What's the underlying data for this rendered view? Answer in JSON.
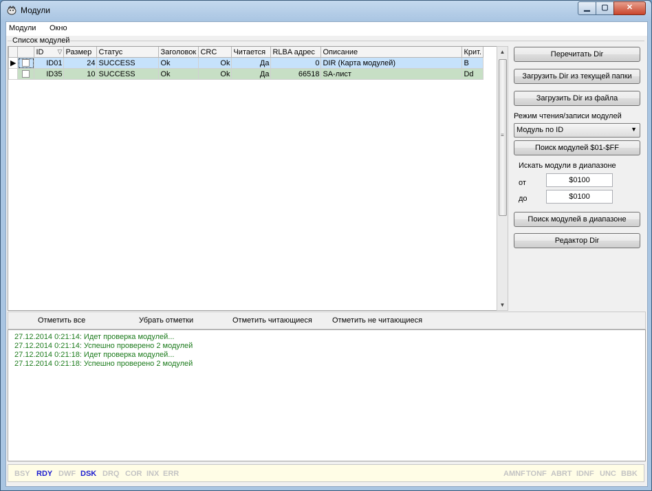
{
  "window": {
    "title": "Модули",
    "minimize": "▁",
    "maximize": "▢",
    "close": "✕"
  },
  "menu": {
    "items": [
      "Модули",
      "Окно"
    ]
  },
  "group": {
    "label": "Список модулей"
  },
  "table": {
    "headers": [
      "ID",
      "Размер",
      "Статус",
      "Заголовок",
      "CRC",
      "Читается",
      "RLBA адрес",
      "Описание",
      "Крит."
    ],
    "sort_indicator": "▽",
    "rows": [
      {
        "id": "ID01",
        "size": "24",
        "status": "SUCCESS",
        "header": "Ok",
        "crc": "Ok",
        "readable": "Да",
        "rlba": "0",
        "description": "DIR (Карта модулей)",
        "crit": "B"
      },
      {
        "id": "ID35",
        "size": "10",
        "status": "SUCCESS",
        "header": "Ok",
        "crc": "Ok",
        "readable": "Да",
        "rlba": "66518",
        "description": "SA-лист",
        "crit": "Dd"
      }
    ],
    "selected_row_color": "#c6e2fb",
    "second_row_color": "#c7dfc5"
  },
  "side": {
    "reread": "Перечитать Dir",
    "load_current": "Загрузить Dir из текущей папки",
    "load_file": "Загрузить Dir из файла",
    "mode_label": "Режим чтения/записи модулей",
    "mode_value": "Модуль по ID",
    "search_all": "Поиск модулей $01-$FF",
    "range_label": "Искать модули в диапазоне",
    "from_label": "от",
    "from_value": "$0100",
    "to_label": "до",
    "to_value": "$0100",
    "search_range": "Поиск модулей в диапазоне",
    "dir_editor": "Редактор Dir"
  },
  "bottom_actions": [
    "Отметить все",
    "Убрать отметки",
    "Отметить читающиеся",
    "Отметить не читающиеся"
  ],
  "log": {
    "color": "#1a7a1a",
    "lines": [
      "27.12.2014 0:21:14: Идет проверка модулей...",
      "27.12.2014 0:21:14: Успешно проверено 2 модулей",
      "27.12.2014 0:21:18: Идет проверка модулей...",
      "27.12.2014 0:21:18: Успешно проверено 2 модулей"
    ]
  },
  "status_flags": {
    "left": [
      {
        "label": "BSY",
        "active": false
      },
      {
        "label": "RDY",
        "active": true
      },
      {
        "label": "DWF",
        "active": false
      },
      {
        "label": "DSK",
        "active": true
      },
      {
        "label": "DRQ",
        "active": false
      },
      {
        "label": "COR",
        "active": false
      },
      {
        "label": "INX",
        "active": false
      },
      {
        "label": "ERR",
        "active": false
      }
    ],
    "right": [
      {
        "label": "AMNF",
        "active": false
      },
      {
        "label": "TONF",
        "active": false
      },
      {
        "label": "ABRT",
        "active": false
      },
      {
        "label": "IDNF",
        "active": false
      },
      {
        "label": "UNC",
        "active": false
      },
      {
        "label": "BBK",
        "active": false
      }
    ],
    "active_color": "#1a1ad0",
    "inactive_color": "#c3c3c3"
  }
}
